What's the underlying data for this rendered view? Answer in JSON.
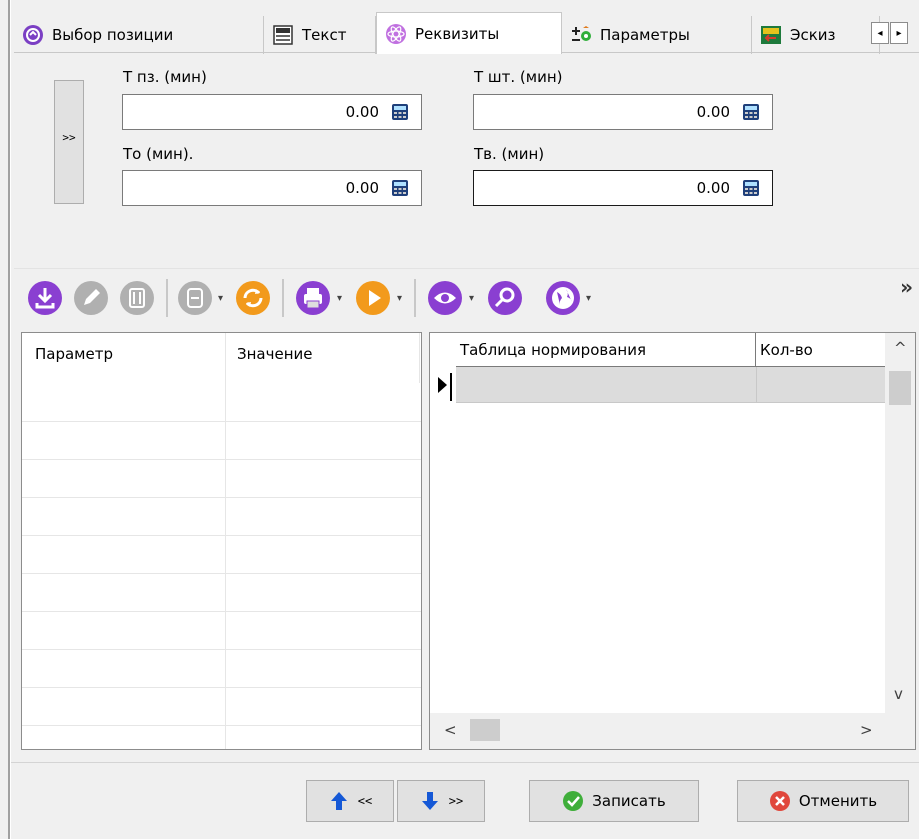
{
  "tabs": [
    {
      "label": "Выбор позиции",
      "icon": "position-select-icon",
      "active": false
    },
    {
      "label": "Текст",
      "icon": "text-document-icon",
      "active": false
    },
    {
      "label": "Реквизиты",
      "icon": "atom-icon",
      "active": true
    },
    {
      "label": "Параметры",
      "icon": "parameters-icon",
      "active": false
    },
    {
      "label": "Эскиз",
      "icon": "sketch-icon",
      "active": false
    }
  ],
  "tab_scroll": {
    "left": "◂",
    "right": "▸"
  },
  "expand_label": ">>",
  "fields": {
    "tpz": {
      "label": "Т пз. (мин)",
      "value": "0.00"
    },
    "tsht": {
      "label": "Т шт. (мин)",
      "value": "0.00"
    },
    "to": {
      "label": "То (мин).",
      "value": "0.00"
    },
    "tv": {
      "label": "Тв. (мин)",
      "value": "0.00"
    }
  },
  "toolbar": {
    "more": "»",
    "buttons": [
      "import-icon",
      "edit-icon",
      "delete-icon",
      "collapse-icon",
      "refresh-icon",
      "print-icon",
      "play-icon",
      "view-icon",
      "search-icon",
      "globe-icon"
    ]
  },
  "params_grid": {
    "columns": [
      "Параметр",
      "Значение"
    ],
    "rows": []
  },
  "norm_grid": {
    "columns": [
      "Таблица нормирования",
      "Кол-во"
    ],
    "rows": [
      [
        "",
        ""
      ]
    ]
  },
  "scroll_glyphs": {
    "up": "^",
    "down": "v",
    "left": "<",
    "right": ">"
  },
  "footer": {
    "prev_label": "<<",
    "next_label": ">>",
    "save_label": "Записать",
    "cancel_label": "Отменить"
  },
  "colors": {
    "toolbar_purple": "#8a3fd1",
    "toolbar_orange": "#f29a1c",
    "disabled_gray": "#b0b0b0",
    "save_green": "#3fae3a",
    "cancel_red": "#e0473c",
    "arrow_blue": "#1558d6"
  }
}
